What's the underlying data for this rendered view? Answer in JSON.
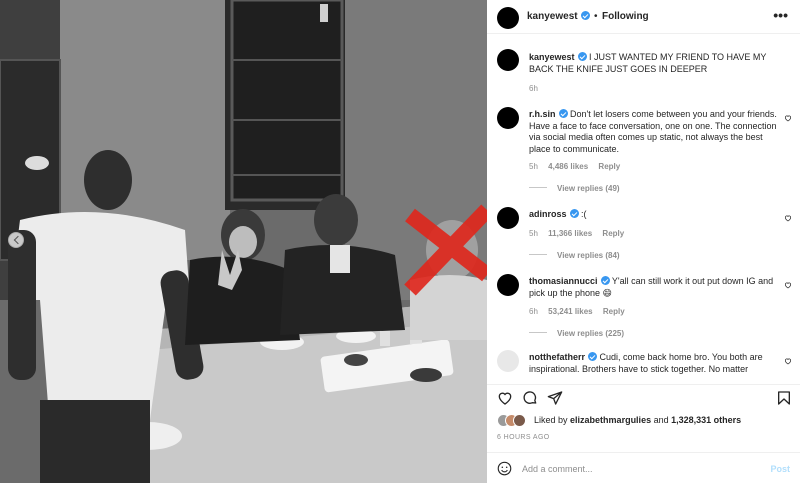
{
  "post": {
    "username": "kanyewest",
    "follow_separator": "•",
    "follow_status": "Following",
    "more_label": "•••",
    "caption_user": "kanyewest",
    "caption": "I JUST WANTED MY FRIEND TO HAVE MY BACK THE KNIFE JUST GOES IN DEEPER",
    "caption_time": "6h"
  },
  "comments": [
    {
      "user": "r.h.sin",
      "text": "Don't let losers come between you and your friends. Have a face to face conversation, one on one. The connection via social media often comes up static, not always the best place to communicate.",
      "time": "5h",
      "likes": "4,486 likes",
      "reply": "Reply",
      "view_replies": "View replies (49)"
    },
    {
      "user": "adinross",
      "text": ":(",
      "time": "5h",
      "likes": "11,366 likes",
      "reply": "Reply",
      "view_replies": "View replies (84)"
    },
    {
      "user": "thomasiannucci",
      "text": "Y'all can still work it out put down IG and pick up the phone 😄",
      "time": "6h",
      "likes": "53,241 likes",
      "reply": "Reply",
      "view_replies": "View replies (225)"
    },
    {
      "user": "notthefatherr",
      "text": "Cudi, come back home bro. You both are inspirational. Brothers have to stick together. No matter"
    }
  ],
  "likes": {
    "prefix": "Liked by",
    "user": "elizabethmargulies",
    "middle": "and",
    "count": "1,328,331 others"
  },
  "timestamp": "6 HOURS AGO",
  "add_comment": {
    "placeholder": "Add a comment...",
    "post_label": "Post"
  },
  "icons": {
    "like": "heart-icon",
    "comment": "comment-icon",
    "share": "share-icon",
    "save": "bookmark-icon",
    "emoji": "smiley-icon"
  },
  "colors": {
    "verified": "#3897f0",
    "post_button": "#b2dffc",
    "red_mark": "#e0261b"
  }
}
